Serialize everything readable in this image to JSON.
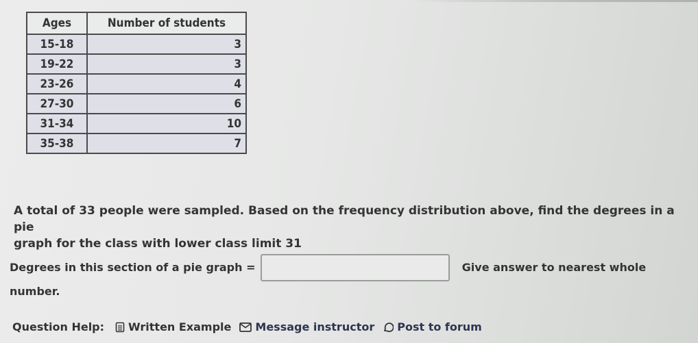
{
  "table": {
    "headers": [
      "Ages",
      "Number of students"
    ],
    "rows": [
      {
        "ages": "15-18",
        "count": "3"
      },
      {
        "ages": "19-22",
        "count": "3"
      },
      {
        "ages": "23-26",
        "count": "4"
      },
      {
        "ages": "27-30",
        "count": "6"
      },
      {
        "ages": "31-34",
        "count": "10"
      },
      {
        "ages": "35-38",
        "count": "7"
      }
    ]
  },
  "question": {
    "line1": "A total of 33 people were sampled. Based on the frequency distribution above, find the degrees in a pie",
    "line2": "graph for the class with lower class limit 31"
  },
  "answer": {
    "label": "Degrees in this section of a pie graph =",
    "value": "",
    "placeholder": "",
    "note_part1": "Give answer to nearest whole",
    "note_part2": "number."
  },
  "help": {
    "label": "Question Help:",
    "links": [
      {
        "icon": "document-icon",
        "label": "Written Example"
      },
      {
        "icon": "envelope-icon",
        "label": "Message instructor"
      },
      {
        "icon": "speech-bubble-icon",
        "label": "Post to forum"
      }
    ]
  }
}
